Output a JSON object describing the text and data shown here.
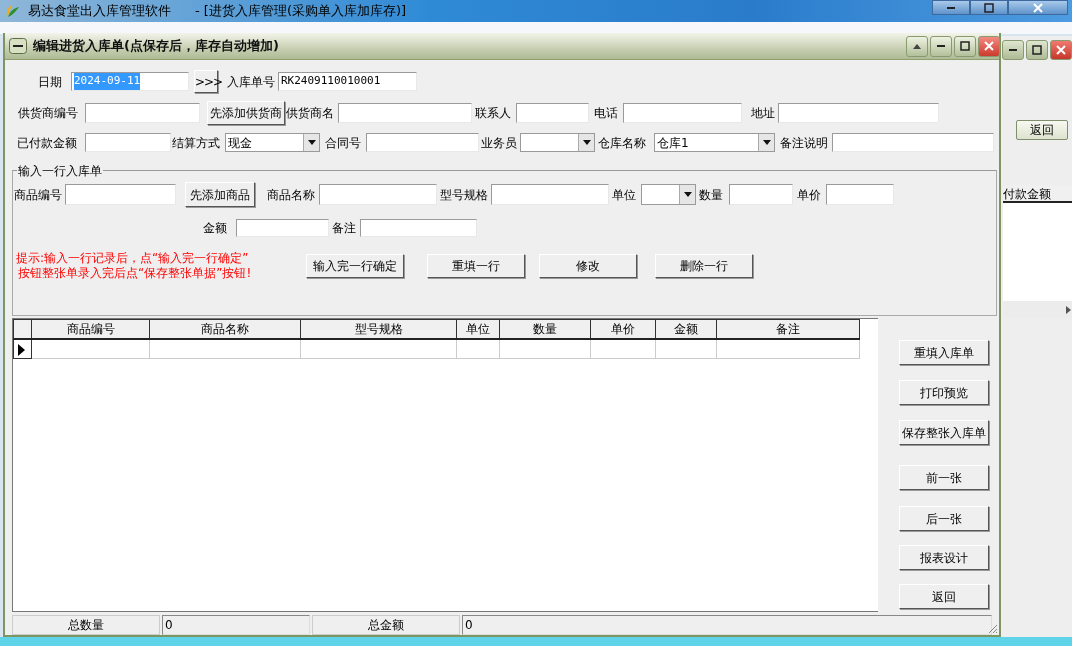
{
  "app": {
    "title": "易达食堂出入库管理软件",
    "document": "- [进货入库管理(采购单入库加库存)]"
  },
  "back_window": {
    "button": "返回",
    "column_header": "付款金额"
  },
  "dialog": {
    "title": "编辑进货入库单(点保存后，库存自动增加)",
    "header_rows": [
      {
        "items": [
          {
            "kind": "label",
            "text": "日期"
          },
          {
            "kind": "input",
            "value": "2024-09-11",
            "text_selected": true
          },
          {
            "kind": "button",
            "text": ">>>"
          },
          {
            "kind": "label",
            "text": "入库单号"
          },
          {
            "kind": "input",
            "value": "RK2409110010001",
            "text_selected": false
          }
        ]
      },
      {
        "items": [
          {
            "kind": "label",
            "text": "供货商编号"
          },
          {
            "kind": "input"
          },
          {
            "kind": "button",
            "text": "先添加供货商"
          },
          {
            "kind": "label",
            "text": "供货商名"
          },
          {
            "kind": "input"
          },
          {
            "kind": "label",
            "text": "联系人"
          },
          {
            "kind": "input"
          },
          {
            "kind": "label",
            "text": "电话"
          },
          {
            "kind": "input"
          },
          {
            "kind": "label",
            "text": "地址"
          },
          {
            "kind": "input"
          }
        ]
      },
      {
        "items": [
          {
            "kind": "label",
            "text": "已付款金额"
          },
          {
            "kind": "input"
          },
          {
            "kind": "label",
            "text": "结算方式"
          },
          {
            "kind": "select",
            "value": "现金"
          },
          {
            "kind": "label",
            "text": "合同号"
          },
          {
            "kind": "input"
          },
          {
            "kind": "label",
            "text": "业务员"
          },
          {
            "kind": "select"
          },
          {
            "kind": "label",
            "text": "仓库名称"
          },
          {
            "kind": "select",
            "value": "仓库1"
          },
          {
            "kind": "label",
            "text": "备注说明"
          },
          {
            "kind": "input"
          }
        ]
      }
    ],
    "line_entry": {
      "title": "输入一行入库单",
      "rows": [
        {
          "items": [
            {
              "kind": "label",
              "text": "商品编号"
            },
            {
              "kind": "input"
            },
            {
              "kind": "button",
              "text": "先添加商品"
            },
            {
              "kind": "label",
              "text": "商品名称"
            },
            {
              "kind": "input"
            },
            {
              "kind": "label",
              "text": "型号规格"
            },
            {
              "kind": "input"
            },
            {
              "kind": "label",
              "text": "单位"
            },
            {
              "kind": "select"
            },
            {
              "kind": "label",
              "text": "数量"
            },
            {
              "kind": "input"
            },
            {
              "kind": "label",
              "text": "单价"
            },
            {
              "kind": "input"
            }
          ]
        },
        {
          "items": [
            {
              "kind": "label",
              "text": "金额"
            },
            {
              "kind": "input"
            },
            {
              "kind": "label",
              "text": "备注"
            },
            {
              "kind": "input"
            }
          ]
        }
      ],
      "hint": [
        "提示:输入一行记录后，点“输入完一行确定”",
        "按钮整张单录入完后点“保存整张单据”按钮!"
      ],
      "buttons": [
        "输入完一行确定",
        "重填一行",
        "修改",
        "删除一行"
      ]
    },
    "grid": {
      "columns": [
        "商品编号",
        "商品名称",
        "型号规格",
        "单位",
        "数量",
        "单价",
        "金额",
        "备注"
      ],
      "rows": [
        {
          "current": true
        }
      ]
    },
    "side_buttons": [
      "重填入库单",
      "打印预览",
      "保存整张入库单",
      "前一张",
      "后一张",
      "报表设计",
      "返回"
    ],
    "totals": [
      {
        "label": "总数量",
        "value": "0"
      },
      {
        "label": "总金额",
        "value": "0"
      }
    ]
  }
}
